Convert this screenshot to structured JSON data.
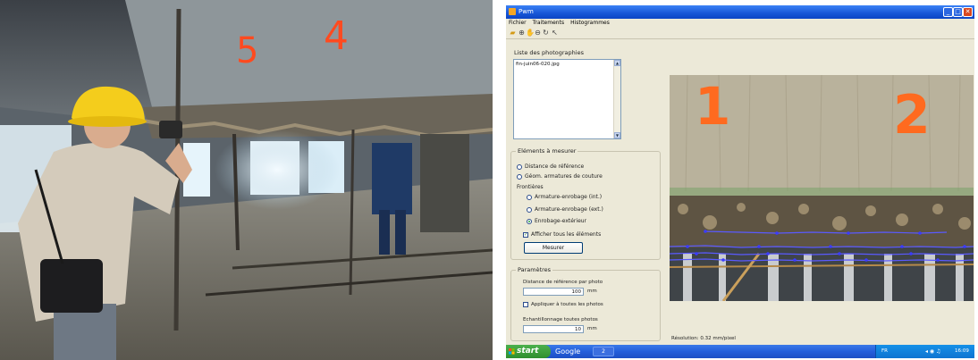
{
  "window": {
    "title": "Pwm",
    "controls": {
      "minimize": "_",
      "maximize": "□",
      "close": "✕"
    }
  },
  "menu": [
    "Fichier",
    "Traitements",
    "Histogrammes"
  ],
  "toolbar_icons": [
    "folder-icon",
    "zoom-in-icon",
    "pan-icon",
    "zoom-out-icon",
    "rotate-icon",
    "pointer-icon"
  ],
  "photos": {
    "title": "Liste des photographies",
    "items": [
      "fin-juin06-020.jpg"
    ]
  },
  "elements": {
    "title": "Eléments à mesurer",
    "options": [
      "Distance de référence",
      "Géom. armatures de couture"
    ],
    "frontieres_label": "Frontières",
    "frontieres": [
      "Armature-enrobage (int.)",
      "Armature-enrobage (ext.)",
      "Enrobage-extérieur"
    ],
    "selected": "Enrobage-extérieur",
    "show_all_label": "Afficher tous les éléments",
    "show_all_checked": true,
    "measure_button": "Mesurer"
  },
  "params": {
    "title": "Paramètres",
    "ref_distance_label": "Distance de référence par photo",
    "ref_distance_value": "100",
    "ref_distance_unit": "mm",
    "apply_all_label": "Appliquer à toutes les photos",
    "apply_all_checked": false,
    "sampling_label": "Echantillonnage toutes photos",
    "sampling_value": "10",
    "sampling_unit": "mm"
  },
  "resolution_text": "Résolution: 0.32 mm/pixel",
  "photo_markings": [
    "1",
    "2"
  ],
  "taskbar": {
    "start": "start",
    "google": "Google",
    "task": "2",
    "lang": "FR",
    "clock": "16:09"
  },
  "colors": {
    "titlebar": "#1756d6",
    "start": "#2f8f2f",
    "marking": "#ff6a1f",
    "measure_line": "#5a5aff"
  }
}
